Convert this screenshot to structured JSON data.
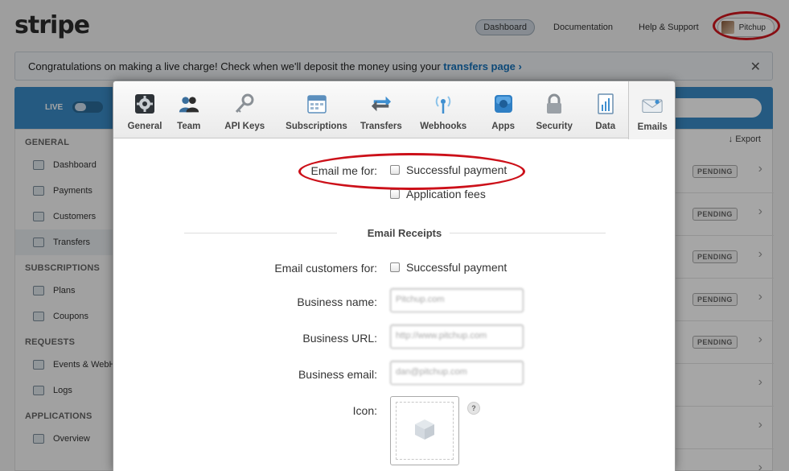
{
  "app": {
    "logo": "stripe",
    "nav": [
      {
        "label": "Dashboard"
      },
      {
        "label": "Documentation"
      },
      {
        "label": "Help & Support"
      }
    ],
    "account_name": "Pitchup"
  },
  "banner": {
    "text": "Congratulations on making a live charge! Check when we'll deposit the money using your ",
    "link": "transfers page ›",
    "close": "✕"
  },
  "sidebar": {
    "live_label": "LIVE",
    "sections": [
      {
        "title": "GENERAL",
        "items": [
          "Dashboard",
          "Payments",
          "Customers",
          "Transfers"
        ]
      },
      {
        "title": "SUBSCRIPTIONS",
        "items": [
          "Plans",
          "Coupons"
        ]
      },
      {
        "title": "REQUESTS",
        "items": [
          "Events & WebH",
          "Logs"
        ]
      },
      {
        "title": "APPLICATIONS",
        "items": [
          "Overview"
        ]
      }
    ]
  },
  "main": {
    "export_label": "↓ Export",
    "status_label": "PENDING",
    "chevron": "›"
  },
  "modal": {
    "tabs": [
      {
        "label": "General",
        "icon": "gear-icon"
      },
      {
        "label": "Team",
        "icon": "team-icon"
      },
      {
        "label": "API Keys",
        "icon": "key-icon"
      },
      {
        "label": "Subscriptions",
        "icon": "calendar-icon"
      },
      {
        "label": "Transfers",
        "icon": "arrows-icon"
      },
      {
        "label": "Webhooks",
        "icon": "broadcast-icon"
      },
      {
        "label": "Apps",
        "icon": "apps-icon"
      },
      {
        "label": "Security",
        "icon": "lock-icon"
      },
      {
        "label": "Data",
        "icon": "chart-icon"
      },
      {
        "label": "Emails",
        "icon": "envelope-icon"
      }
    ],
    "active_tab": "Emails",
    "email_me_label": "Email me for:",
    "email_me_options": [
      "Successful payment",
      "Application fees"
    ],
    "receipts_title": "Email Receipts",
    "email_customers_label": "Email customers for:",
    "email_customers_option": "Successful payment",
    "business_name_label": "Business name:",
    "business_name_value": "Pitchup.com",
    "business_url_label": "Business URL:",
    "business_url_value": "http://www.pitchup.com",
    "business_email_label": "Business email:",
    "business_email_value": "dan@pitchup.com",
    "icon_label": "Icon:",
    "help": "?"
  },
  "colors": {
    "accent_blue": "#3a8bc6",
    "highlight_red": "#cc1019"
  }
}
